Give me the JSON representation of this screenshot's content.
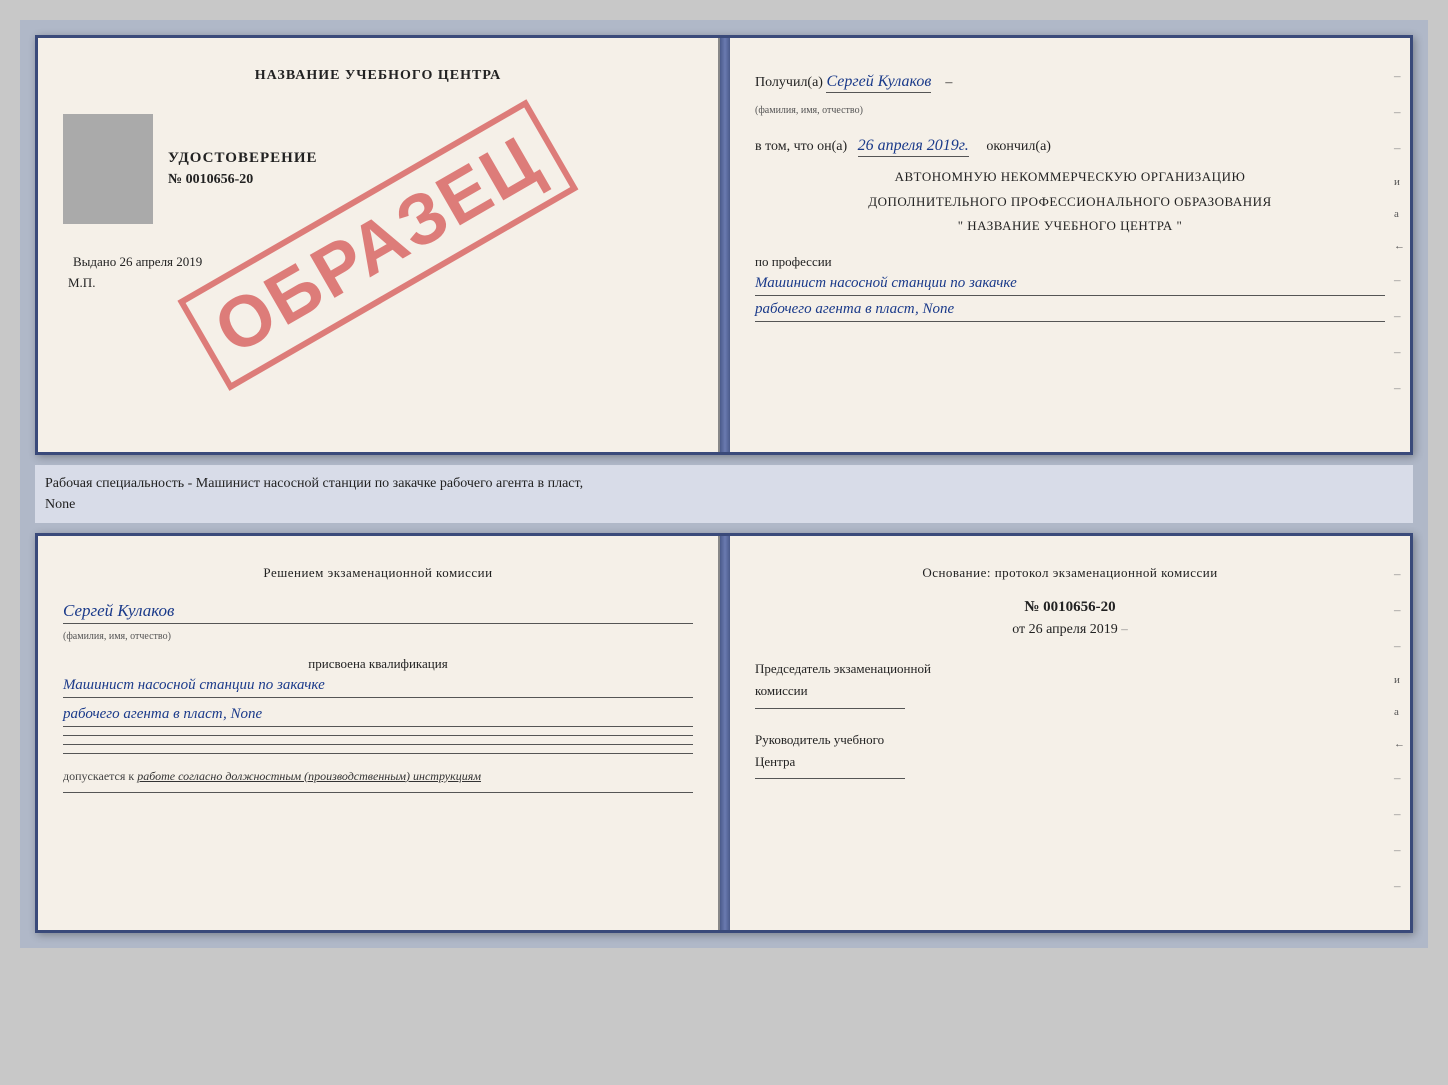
{
  "top_doc": {
    "left": {
      "center_title": "НАЗВАНИЕ УЧЕБНОГО ЦЕНТРА",
      "udostoverenie_label": "УДОСТОВЕРЕНИЕ",
      "number": "№ 0010656-20",
      "vydano": "Выдано 26 апреля 2019",
      "mp": "М.П.",
      "watermark": "ОБРАЗЕЦ"
    },
    "right": {
      "poluchil": "Получил(а)",
      "name_handwritten": "Сергей Кулаков",
      "familiya_label": "(фамилия, имя, отчество)",
      "v_tom_chto": "в том, что он(а)",
      "date_handwritten": "26 апреля 2019г.",
      "okonchil": "окончил(а)",
      "org_line1": "АВТОНОМНУЮ НЕКОММЕРЧЕСКУЮ ОРГАНИЗАЦИЮ",
      "org_line2": "ДОПОЛНИТЕЛЬНОГО ПРОФЕССИОНАЛЬНОГО ОБРАЗОВАНИЯ",
      "org_line3": "\"   НАЗВАНИЕ УЧЕБНОГО ЦЕНТРА   \"",
      "po_professii": "по профессии",
      "profession1": "Машинист насосной станции по закачке",
      "profession2": "рабочего агента в пласт, None",
      "right_marks": [
        "–",
        "–",
        "–",
        "и",
        "а",
        "←",
        "–",
        "–",
        "–",
        "–"
      ]
    }
  },
  "caption": {
    "text": "Рабочая специальность - Машинист насосной станции по закачке рабочего агента в пласт,",
    "text2": "None"
  },
  "bottom_doc": {
    "left": {
      "title": "Решением  экзаменационной  комиссии",
      "name_handwritten": "Сергей Кулаков",
      "familiya_label": "(фамилия, имя, отчество)",
      "prisvoena": "присвоена квалификация",
      "profession1": "Машинист насосной станции по закачке",
      "profession2": "рабочего агента в пласт, None",
      "dopuskaetsya": "допускается к",
      "rabota": "работе согласно должностным (производственным) инструкциям"
    },
    "right": {
      "osnovaniye_label": "Основание:  протокол экзаменационной  комиссии",
      "number": "№  0010656-20",
      "ot_label": "от",
      "date": "26 апреля 2019",
      "predsedatel_label": "Председатель экзаменационной",
      "komissii_label": "комиссии",
      "rukovoditel_label": "Руководитель учебного",
      "centra_label": "Центра",
      "right_marks": [
        "–",
        "–",
        "–",
        "и",
        "а",
        "←",
        "–",
        "–",
        "–",
        "–"
      ]
    }
  }
}
